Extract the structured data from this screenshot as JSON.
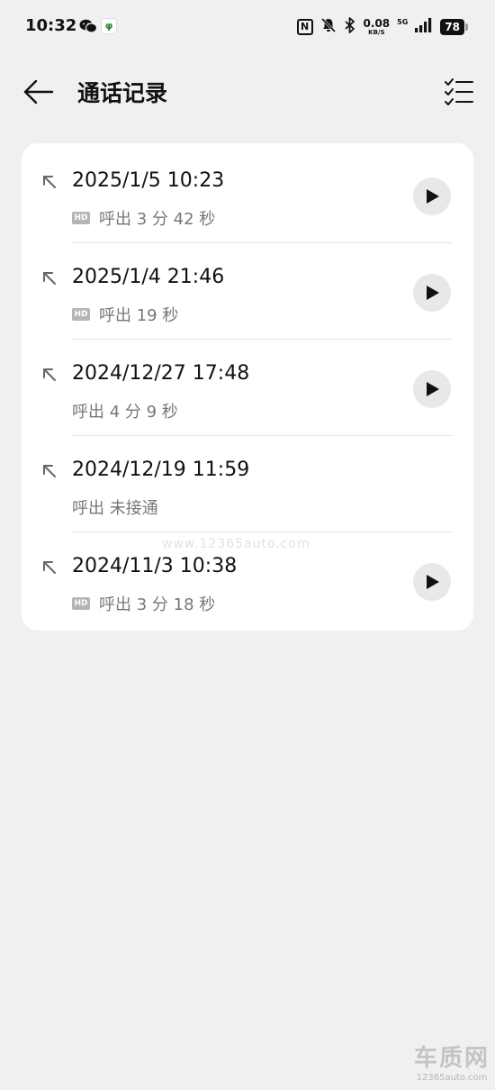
{
  "status_bar": {
    "time": "10:32",
    "net_speed": "0.08",
    "net_speed_unit": "KB/S",
    "network": "5G",
    "battery": "78",
    "nfc_label": "N"
  },
  "header": {
    "title": "通话记录"
  },
  "calls": [
    {
      "datetime": "2025/1/5 10:23",
      "hd": "HD",
      "detail": "呼出  3 分 42 秒"
    },
    {
      "datetime": "2025/1/4 21:46",
      "hd": "HD",
      "detail": "呼出  19 秒"
    },
    {
      "datetime": "2024/12/27 17:48",
      "detail": "呼出  4 分 9 秒"
    },
    {
      "datetime": "2024/12/19 11:59",
      "detail": "呼出 未接通"
    },
    {
      "datetime": "2024/11/3 10:38",
      "hd": "HD",
      "detail": "呼出  3 分 18 秒"
    }
  ],
  "watermark": {
    "url": "www.12365auto.com",
    "logo": "车质网",
    "logo_sub": "12365auto.com"
  },
  "colors": {
    "background": "#eff0f2",
    "card": "#ffffff",
    "play_button": "#e8e8ea",
    "secondary_text": "#777777"
  },
  "icons": {
    "back": "arrow-left-icon",
    "multiselect": "checklist-icon",
    "direction": "outgoing-call-arrow-icon",
    "play": "play-icon"
  }
}
